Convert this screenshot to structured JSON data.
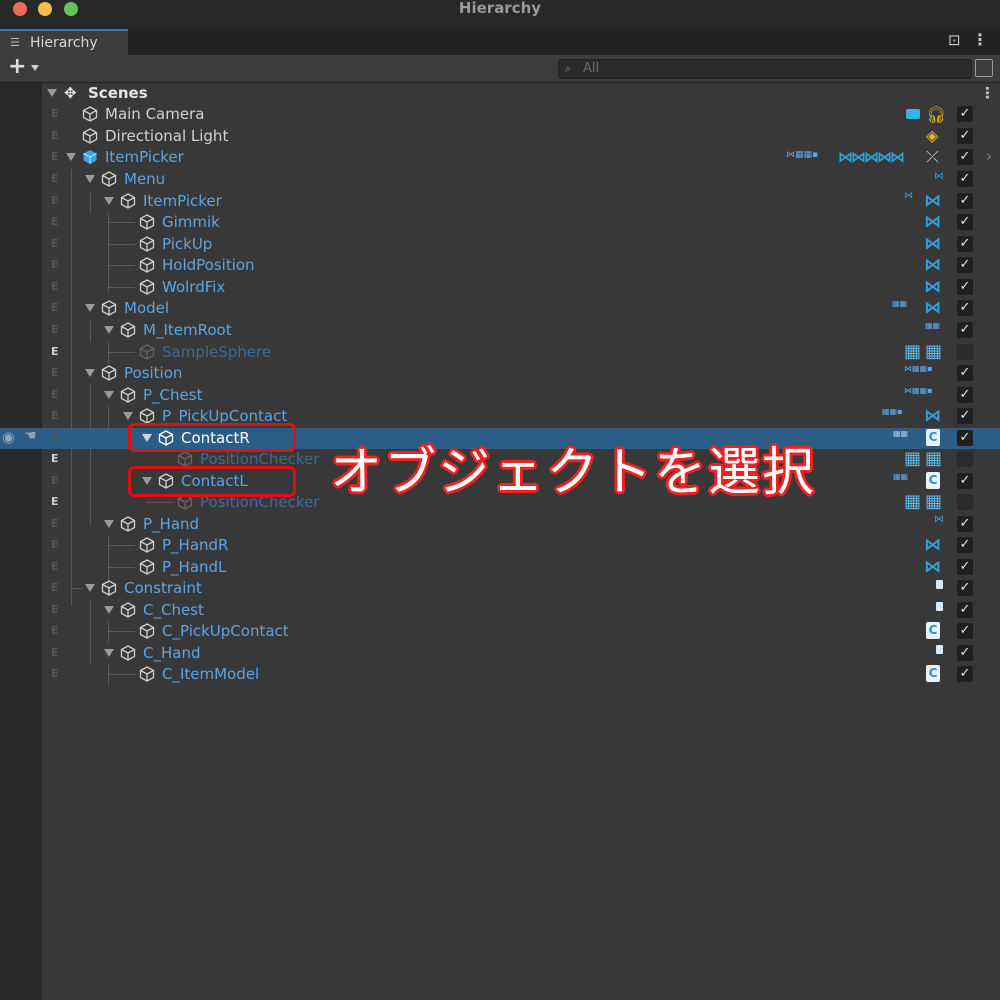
{
  "window": {
    "title": "Hierarchy"
  },
  "tab": {
    "label": "Hierarchy"
  },
  "search": {
    "placeholder": "All"
  },
  "scenes_label": "Scenes",
  "rows": [
    {
      "label": "Main Camera",
      "color": "#d2d2d2"
    },
    {
      "label": "Directional Light",
      "color": "#d2d2d2"
    },
    {
      "label": "ItemPicker",
      "color": "#5aa6e8"
    },
    {
      "label": "Menu",
      "color": "#5aa6e8"
    },
    {
      "label": "ItemPicker",
      "color": "#5aa6e8"
    },
    {
      "label": "Gimmik",
      "color": "#5aa6e8"
    },
    {
      "label": "PickUp",
      "color": "#5aa6e8"
    },
    {
      "label": "HoldPosition",
      "color": "#5aa6e8"
    },
    {
      "label": "WolrdFix",
      "color": "#5aa6e8"
    },
    {
      "label": "Model",
      "color": "#5aa6e8"
    },
    {
      "label": "M_ItemRoot",
      "color": "#5aa6e8"
    },
    {
      "label": "SampleSphere",
      "color": "#3f6a94"
    },
    {
      "label": "Position",
      "color": "#5aa6e8"
    },
    {
      "label": "P_Chest",
      "color": "#5aa6e8"
    },
    {
      "label": "P_PickUpContact",
      "color": "#5aa6e8"
    },
    {
      "label": "ContactR",
      "color": "#ffffff"
    },
    {
      "label": "PositionChecker",
      "color": "#3f6a94"
    },
    {
      "label": "ContactL",
      "color": "#5aa6e8"
    },
    {
      "label": "PositionChecker",
      "color": "#3f6a94"
    },
    {
      "label": "P_Hand",
      "color": "#5aa6e8"
    },
    {
      "label": "P_HandR",
      "color": "#5aa6e8"
    },
    {
      "label": "P_HandL",
      "color": "#5aa6e8"
    },
    {
      "label": "Constraint",
      "color": "#5aa6e8"
    },
    {
      "label": "C_Chest",
      "color": "#5aa6e8"
    },
    {
      "label": "C_PickUpContact",
      "color": "#5aa6e8"
    },
    {
      "label": "C_Hand",
      "color": "#5aa6e8"
    },
    {
      "label": "C_ItemModel",
      "color": "#5aa6e8"
    }
  ],
  "editor_only_marker": "E",
  "annotation": {
    "text": "オブジェクトを選択"
  },
  "colors": {
    "accent": "#2c5d87",
    "prefab": "#5aa6e8",
    "highlight": "#e01010"
  }
}
